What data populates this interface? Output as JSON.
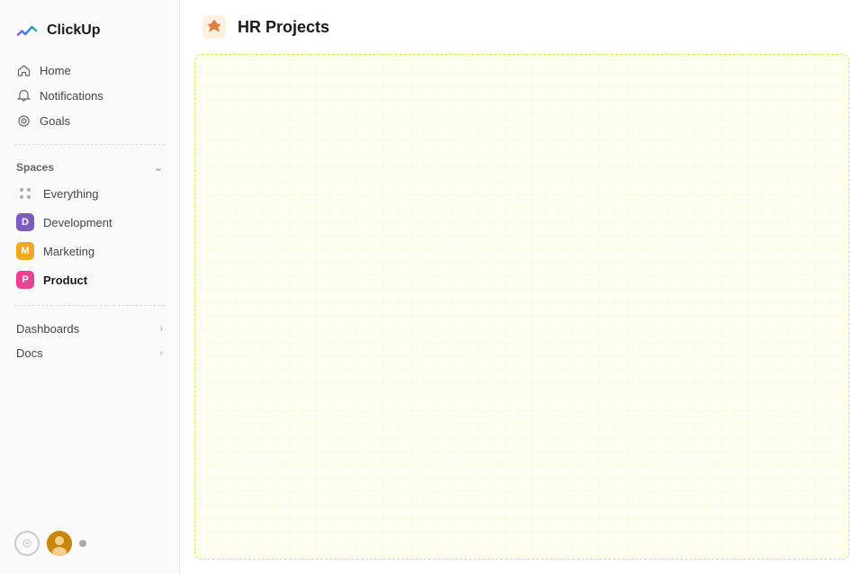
{
  "logo": {
    "text": "ClickUp"
  },
  "nav": {
    "home_label": "Home",
    "notifications_label": "Notifications",
    "goals_label": "Goals"
  },
  "spaces": {
    "label": "Spaces",
    "items": [
      {
        "id": "everything",
        "label": "Everything",
        "type": "everything"
      },
      {
        "id": "development",
        "label": "Development",
        "type": "badge",
        "color": "#7c5cbf",
        "letter": "D"
      },
      {
        "id": "marketing",
        "label": "Marketing",
        "type": "badge",
        "color": "#f5a623",
        "letter": "M"
      },
      {
        "id": "product",
        "label": "Product",
        "type": "badge",
        "color": "#e84393",
        "letter": "P",
        "active": true
      }
    ]
  },
  "collapsibles": [
    {
      "id": "dashboards",
      "label": "Dashboards"
    },
    {
      "id": "docs",
      "label": "Docs"
    }
  ],
  "main": {
    "project_title": "HR Projects"
  },
  "bottom": {
    "status_label": "..."
  }
}
